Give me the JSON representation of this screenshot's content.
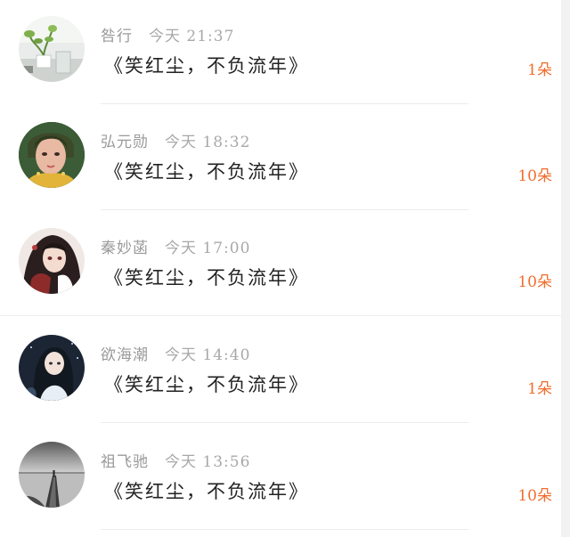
{
  "gift_list": {
    "items": [
      {
        "user_name": "咎行",
        "time": "今天 21:37",
        "title": "《笑红尘，不负流年》",
        "count": "1朵",
        "avatar_icon": "potted-plant-photo"
      },
      {
        "user_name": "弘元勋",
        "time": "今天 18:32",
        "title": "《笑红尘，不负流年》",
        "count": "10朵",
        "avatar_icon": "woman-portrait-photo"
      },
      {
        "user_name": "秦妙菡",
        "time": "今天 17:00",
        "title": "《笑红尘，不负流年》",
        "count": "10朵",
        "avatar_icon": "anime-character-illustration"
      },
      {
        "user_name": "欲海潮",
        "time": "今天 14:40",
        "title": "《笑红尘，不负流年》",
        "count": "1朵",
        "avatar_icon": "anime-girl-night-illustration"
      },
      {
        "user_name": "祖飞驰",
        "time": "今天 13:56",
        "title": "《笑红尘，不负流年》",
        "count": "10朵",
        "avatar_icon": "pier-landscape-photo"
      }
    ]
  },
  "colors": {
    "count_accent": "#f06d2c",
    "meta_text": "#9a9a9a",
    "title_text": "#222222",
    "divider": "#ececec"
  }
}
